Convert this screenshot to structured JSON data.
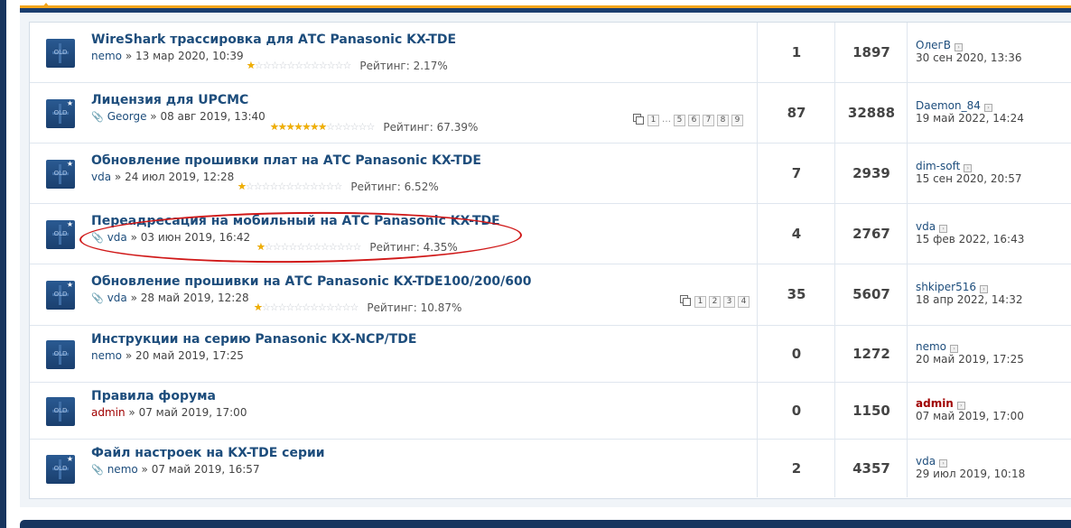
{
  "rating_label": "Рейтинг:",
  "topics": [
    {
      "title": "WireShark трассировка для АТС Panasonic KX-TDE",
      "author": "nemo",
      "author_admin": false,
      "date": "13 мар 2020, 10:39",
      "attachment": false,
      "rating_pct": "2.17%",
      "stars_filled": 0.2,
      "replies": "1",
      "views": "1897",
      "last_author": "ОлегВ",
      "last_admin": false,
      "last_date": "30 сен 2020, 13:36",
      "pages": []
    },
    {
      "title": "Лицензия для UPCMC",
      "author": "George",
      "author_admin": false,
      "date": "08 авг 2019, 13:40",
      "attachment": true,
      "rating_pct": "67.39%",
      "stars_filled": 6.7,
      "replies": "87",
      "views": "32888",
      "last_author": "Daemon_84",
      "last_admin": false,
      "last_date": "19 май 2022, 14:24",
      "pages": [
        "1",
        "…",
        "5",
        "6",
        "7",
        "8",
        "9"
      ]
    },
    {
      "title": "Обновление прошивки плат на АТС Panasonic KX-TDE",
      "author": "vda",
      "author_admin": false,
      "date": "24 июл 2019, 12:28",
      "attachment": false,
      "rating_pct": "6.52%",
      "stars_filled": 0.6,
      "replies": "7",
      "views": "2939",
      "last_author": "dim-soft",
      "last_admin": false,
      "last_date": "15 сен 2020, 20:57",
      "pages": []
    },
    {
      "title": "Переадресация на мобильный на АТС Panasonic KX-TDE",
      "author": "vda",
      "author_admin": false,
      "date": "03 июн 2019, 16:42",
      "attachment": true,
      "rating_pct": "4.35%",
      "stars_filled": 0.4,
      "replies": "4",
      "views": "2767",
      "last_author": "vda",
      "last_admin": false,
      "last_date": "15 фев 2022, 16:43",
      "pages": []
    },
    {
      "title": "Обновление прошивки на АТС Panasonic KX-TDE100/200/600",
      "author": "vda",
      "author_admin": false,
      "date": "28 май 2019, 12:28",
      "attachment": true,
      "rating_pct": "10.87%",
      "stars_filled": 1.0,
      "replies": "35",
      "views": "5607",
      "last_author": "shkiper516",
      "last_admin": false,
      "last_date": "18 апр 2022, 14:32",
      "pages": [
        "1",
        "2",
        "3",
        "4"
      ]
    },
    {
      "title": "Инструкции на серию Panasonic KX-NCP/TDE",
      "author": "nemo",
      "author_admin": false,
      "date": "20 май 2019, 17:25",
      "attachment": false,
      "rating_pct": "",
      "stars_filled": 0,
      "replies": "0",
      "views": "1272",
      "last_author": "nemo",
      "last_admin": false,
      "last_date": "20 май 2019, 17:25",
      "pages": []
    },
    {
      "title": "Правила форума",
      "author": "admin",
      "author_admin": true,
      "date": "07 май 2019, 17:00",
      "attachment": false,
      "rating_pct": "",
      "stars_filled": 0,
      "replies": "0",
      "views": "1150",
      "last_author": "admin",
      "last_admin": true,
      "last_date": "07 май 2019, 17:00",
      "pages": []
    },
    {
      "title": "Файл настроек на KX-TDE серии",
      "author": "nemo",
      "author_admin": false,
      "date": "07 май 2019, 16:57",
      "attachment": true,
      "rating_pct": "",
      "stars_filled": 0,
      "replies": "2",
      "views": "4357",
      "last_author": "vda",
      "last_admin": false,
      "last_date": "29 июл 2019, 10:18",
      "pages": []
    }
  ]
}
